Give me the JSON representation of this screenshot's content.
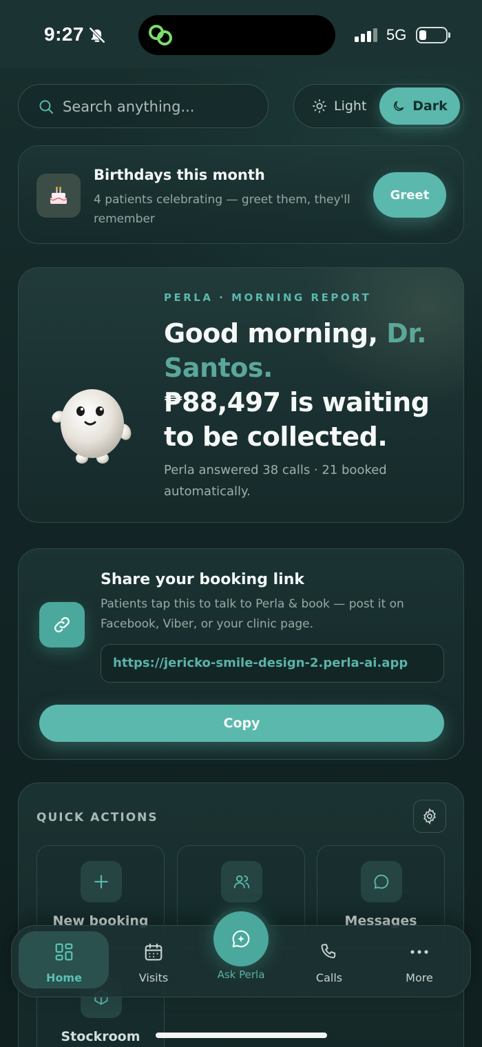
{
  "status_bar": {
    "time": "9:27",
    "network": "5G"
  },
  "search": {
    "placeholder": "Search anything..."
  },
  "theme_toggle": {
    "light_label": "Light",
    "dark_label": "Dark",
    "selected": "Dark"
  },
  "birthday_card": {
    "title": "Birthdays this month",
    "subtitle": "4 patients celebrating — greet them, they'll remember",
    "button_label": "Greet"
  },
  "report_card": {
    "kicker": "PERLA · MORNING REPORT",
    "greeting_prefix": "Good morning, ",
    "greeting_name": "Dr. Santos.",
    "amount_line": "₱88,497 is waiting to be collected.",
    "summary": "Perla answered 38 calls · 21 booked automatically."
  },
  "share_card": {
    "title": "Share your booking link",
    "subtitle": "Patients tap this to talk to Perla & book — post it on Facebook, Viber, or your clinic page.",
    "url": "https://jericko-smile-design-2.perla-ai.app",
    "copy_label": "Copy"
  },
  "quick_actions": {
    "title": "QUICK ACTIONS",
    "items": [
      {
        "label": "New booking",
        "icon": "plus-icon"
      },
      {
        "label": "",
        "icon": "users-icon"
      },
      {
        "label": "Messages",
        "icon": "chat-bubble-icon"
      },
      {
        "label": "Stockroom",
        "icon": "box-icon"
      }
    ]
  },
  "bottom_nav": {
    "items": [
      {
        "label": "Home",
        "icon": "grid-icon",
        "active": true
      },
      {
        "label": "Visits",
        "icon": "calendar-icon"
      },
      {
        "label": "Ask Perla",
        "icon": "sparkle-chat-icon"
      },
      {
        "label": "Calls",
        "icon": "phone-icon"
      },
      {
        "label": "More",
        "icon": "dots-icon"
      }
    ]
  },
  "colors": {
    "accent": "#5bb8ac",
    "background": "#142627",
    "card_border": "#2f4a49"
  }
}
